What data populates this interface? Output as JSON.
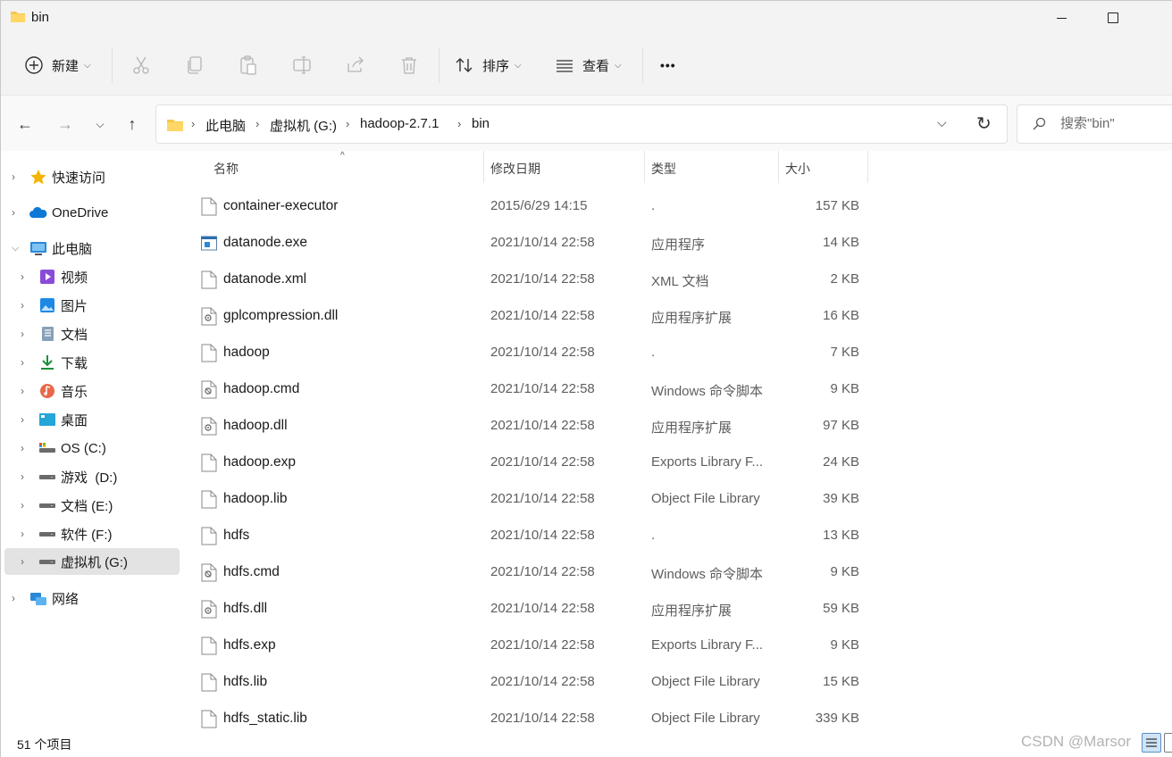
{
  "window": {
    "title": "bin"
  },
  "toolbar": {
    "new_label": "新建",
    "sort_label": "排序",
    "view_label": "查看",
    "more_label": "•••"
  },
  "address": {
    "crumbs": [
      "此电脑",
      "虚拟机 (G:)",
      "hadoop-2.7.1",
      "bin"
    ],
    "search_placeholder": "搜索\"bin\""
  },
  "sidebar": {
    "items": [
      {
        "label": "快速访问",
        "icon": "star-icon"
      },
      {
        "label": "OneDrive",
        "icon": "cloud-icon"
      },
      {
        "label": "此电脑",
        "icon": "computer-icon"
      },
      {
        "label": "视频",
        "icon": "video-icon"
      },
      {
        "label": "图片",
        "icon": "pictures-icon"
      },
      {
        "label": "文档",
        "icon": "documents-icon"
      },
      {
        "label": "下载",
        "icon": "download-icon"
      },
      {
        "label": "音乐",
        "icon": "music-icon"
      },
      {
        "label": "桌面",
        "icon": "desktop-icon"
      },
      {
        "label": "OS (C:)",
        "icon": "drive-c-icon"
      },
      {
        "label": "游戏  (D:)",
        "icon": "drive-icon"
      },
      {
        "label": "文档 (E:)",
        "icon": "drive-icon"
      },
      {
        "label": "软件 (F:)",
        "icon": "drive-icon"
      },
      {
        "label": "虚拟机 (G:)",
        "icon": "drive-icon"
      },
      {
        "label": "网络",
        "icon": "network-icon"
      }
    ]
  },
  "columns": {
    "name": "名称",
    "date": "修改日期",
    "type": "类型",
    "size": "大小"
  },
  "files": [
    {
      "name": "container-executor",
      "date": "2015/6/29 14:15",
      "type": ".",
      "size": "157 KB",
      "icon": "blank-file-icon"
    },
    {
      "name": "datanode.exe",
      "date": "2021/10/14 22:58",
      "type": "应用程序",
      "size": "14 KB",
      "icon": "exe-file-icon"
    },
    {
      "name": "datanode.xml",
      "date": "2021/10/14 22:58",
      "type": "XML 文档",
      "size": "2 KB",
      "icon": "blank-file-icon"
    },
    {
      "name": "gplcompression.dll",
      "date": "2021/10/14 22:58",
      "type": "应用程序扩展",
      "size": "16 KB",
      "icon": "dll-file-icon"
    },
    {
      "name": "hadoop",
      "date": "2021/10/14 22:58",
      "type": ".",
      "size": "7 KB",
      "icon": "blank-file-icon"
    },
    {
      "name": "hadoop.cmd",
      "date": "2021/10/14 22:58",
      "type": "Windows 命令脚本",
      "size": "9 KB",
      "icon": "cmd-file-icon"
    },
    {
      "name": "hadoop.dll",
      "date": "2021/10/14 22:58",
      "type": "应用程序扩展",
      "size": "97 KB",
      "icon": "dll-file-icon"
    },
    {
      "name": "hadoop.exp",
      "date": "2021/10/14 22:58",
      "type": "Exports Library F...",
      "size": "24 KB",
      "icon": "blank-file-icon"
    },
    {
      "name": "hadoop.lib",
      "date": "2021/10/14 22:58",
      "type": "Object File Library",
      "size": "39 KB",
      "icon": "blank-file-icon"
    },
    {
      "name": "hdfs",
      "date": "2021/10/14 22:58",
      "type": ".",
      "size": "13 KB",
      "icon": "blank-file-icon"
    },
    {
      "name": "hdfs.cmd",
      "date": "2021/10/14 22:58",
      "type": "Windows 命令脚本",
      "size": "9 KB",
      "icon": "cmd-file-icon"
    },
    {
      "name": "hdfs.dll",
      "date": "2021/10/14 22:58",
      "type": "应用程序扩展",
      "size": "59 KB",
      "icon": "dll-file-icon"
    },
    {
      "name": "hdfs.exp",
      "date": "2021/10/14 22:58",
      "type": "Exports Library F...",
      "size": "9 KB",
      "icon": "blank-file-icon"
    },
    {
      "name": "hdfs.lib",
      "date": "2021/10/14 22:58",
      "type": "Object File Library",
      "size": "15 KB",
      "icon": "blank-file-icon"
    },
    {
      "name": "hdfs_static.lib",
      "date": "2021/10/14 22:58",
      "type": "Object File Library",
      "size": "339 KB",
      "icon": "blank-file-icon"
    }
  ],
  "status": {
    "count": "51 个项目",
    "watermark": "CSDN @Marsor"
  },
  "colors": {
    "folder": "#f7c84a",
    "selection": "#e3e3e3",
    "accent": "#0067c0"
  }
}
